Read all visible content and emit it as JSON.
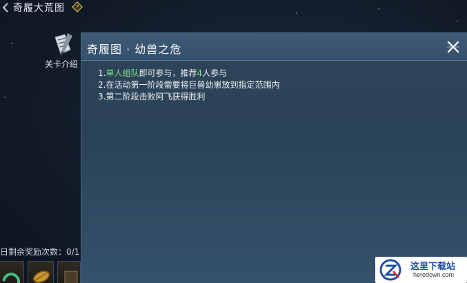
{
  "topbar": {
    "title": "奇履大荒图",
    "help_icon": "help-diamond-icon"
  },
  "side": {
    "intro_label": "关卡介绍",
    "intro_icon": "scroll-brush-icon"
  },
  "rewards": {
    "label": "日剩余奖励次数：0/1",
    "items": [
      "jade-item-icon",
      "gold-leaf-item-icon",
      "reward-item-icon"
    ]
  },
  "modal": {
    "title": "奇履图 · 幼兽之危",
    "close_icon": "close-icon",
    "rules": [
      {
        "prefix": "1.",
        "highlight1": "单人组队",
        "mid": "即可参与，推荐",
        "highlight2": "4",
        "suffix": "人参与"
      },
      {
        "text": "2.在活动第一阶段需要将巨兽幼崽放到指定范围内"
      },
      {
        "text": "3.第二阶段击败阿飞获得胜利"
      }
    ]
  },
  "watermark": {
    "name": "这里下载站",
    "url": "heredown.com"
  },
  "colors": {
    "highlight": "#7fe08a",
    "panel": "#2a4257",
    "header": "#3e5a76"
  }
}
